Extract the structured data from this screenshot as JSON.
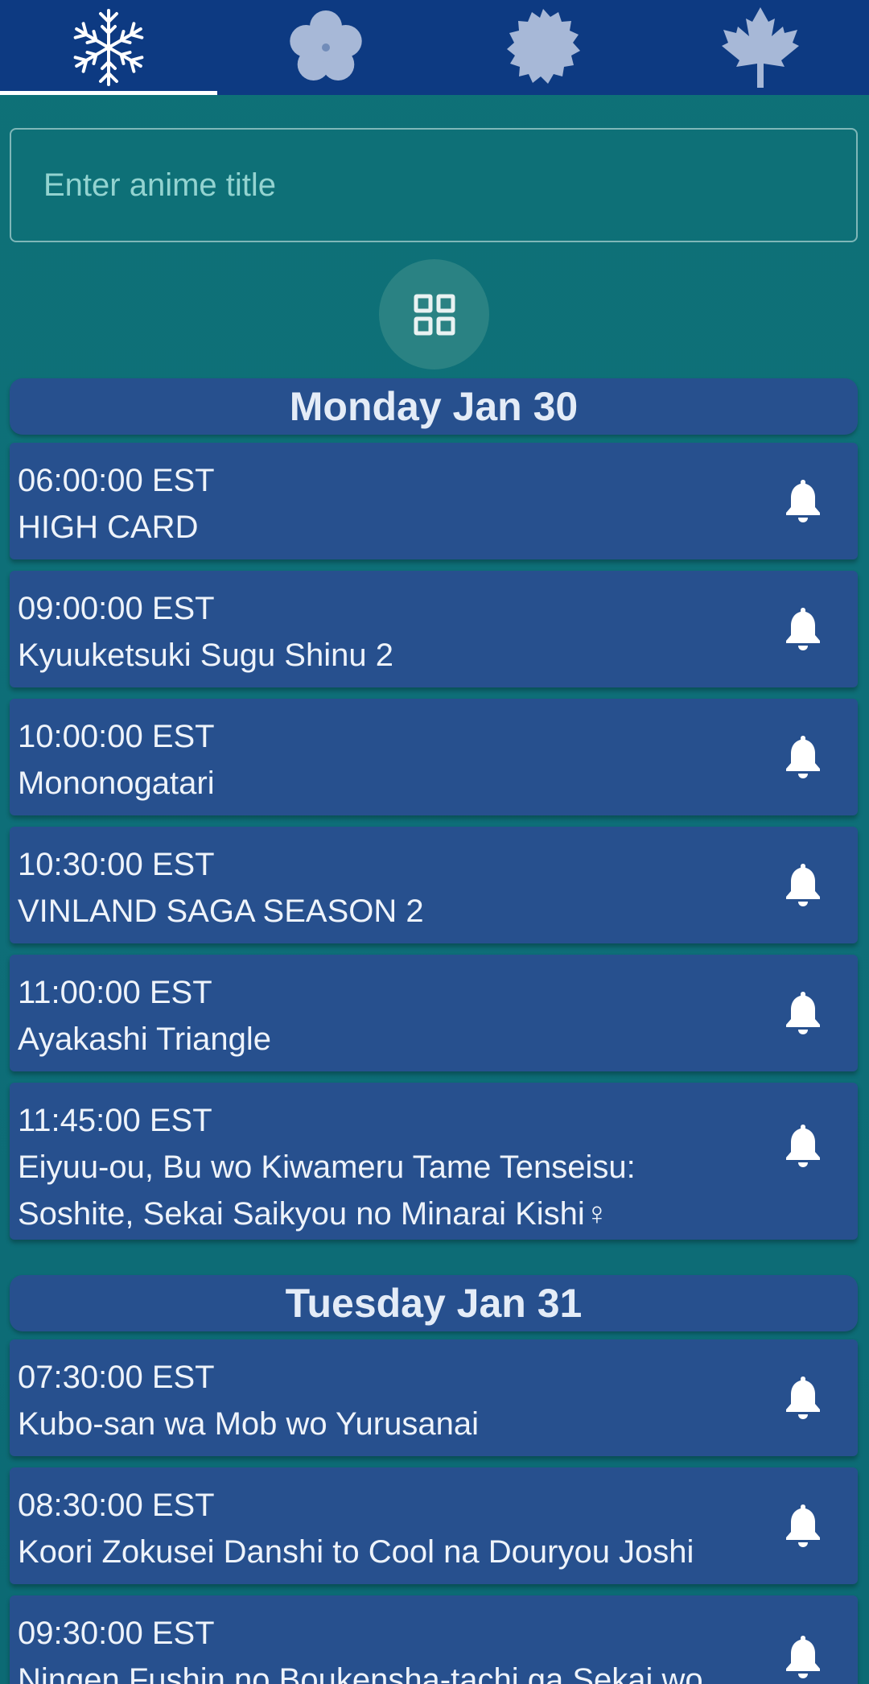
{
  "tabs": [
    {
      "icon": "snowflake-icon",
      "label": "Winter",
      "active": true
    },
    {
      "icon": "flower-icon",
      "label": "Spring",
      "active": false
    },
    {
      "icon": "sun-icon",
      "label": "Summer",
      "active": false
    },
    {
      "icon": "maple-leaf-icon",
      "label": "Fall",
      "active": false
    }
  ],
  "search": {
    "placeholder": "Enter anime title",
    "value": ""
  },
  "view_toggle": {
    "icon": "grid-view-icon"
  },
  "colors": {
    "background": "#0e7177",
    "tab_bar": "#0d3a82",
    "card": "#27508e",
    "tab_icon_inactive": "#a7b8d7",
    "tab_icon_active": "#ffffff"
  },
  "schedule": [
    {
      "day": "Monday Jan 30",
      "items": [
        {
          "time": "06:00:00 EST",
          "title": "HIGH CARD"
        },
        {
          "time": "09:00:00 EST",
          "title": "Kyuuketsuki Sugu Shinu 2"
        },
        {
          "time": "10:00:00 EST",
          "title": "Mononogatari"
        },
        {
          "time": "10:30:00 EST",
          "title": "VINLAND SAGA SEASON 2"
        },
        {
          "time": "11:00:00 EST",
          "title": "Ayakashi Triangle"
        },
        {
          "time": "11:45:00 EST",
          "title": "Eiyuu-ou, Bu wo Kiwameru Tame Tenseisu: Soshite, Sekai Saikyou no Minarai Kishi♀"
        }
      ]
    },
    {
      "day": "Tuesday Jan 31",
      "items": [
        {
          "time": "07:30:00 EST",
          "title": "Kubo-san wa Mob wo Yurusanai"
        },
        {
          "time": "08:30:00 EST",
          "title": "Koori Zokusei Danshi to Cool na Douryou Joshi"
        },
        {
          "time": "09:30:00 EST",
          "title": "Ningen Fushin no Boukensha-tachi ga Sekai wo"
        }
      ]
    }
  ]
}
